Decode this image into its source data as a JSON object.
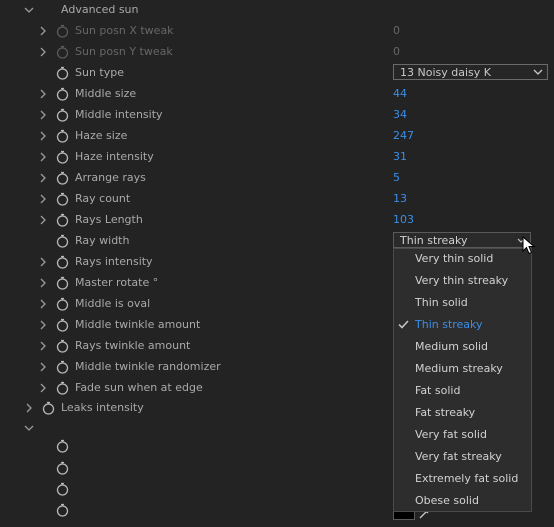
{
  "section": {
    "title": "Advanced sun"
  },
  "rows": [
    {
      "label": "Sun posn X tweak",
      "value": "0",
      "disabled": true
    },
    {
      "label": "Sun posn Y tweak",
      "value": "0",
      "disabled": true
    },
    {
      "label": "Sun type",
      "select": "13 Noisy daisy K"
    },
    {
      "label": "Middle size",
      "value": "44"
    },
    {
      "label": "Middle intensity",
      "value": "34"
    },
    {
      "label": "Haze size",
      "value": "247"
    },
    {
      "label": "Haze intensity",
      "value": "31"
    },
    {
      "label": "Arrange rays",
      "value": "5"
    },
    {
      "label": "Ray count",
      "value": "13"
    },
    {
      "label": "Rays Length",
      "value": "103"
    },
    {
      "label": "Ray width",
      "select": "Thin streaky"
    },
    {
      "label": "Rays intensity"
    },
    {
      "label": "Master rotate °"
    },
    {
      "label": "Middle is oval"
    },
    {
      "label": "Middle twinkle amount"
    },
    {
      "label": "Rays twinkle amount"
    },
    {
      "label": "Middle twinkle randomizer"
    },
    {
      "label": "Fade sun when at edge"
    }
  ],
  "leaks": {
    "label": "Leaks intensity"
  },
  "ray_width_options": [
    "Very thin solid",
    "Very thin streaky",
    "Thin solid",
    "Thin streaky",
    "Medium solid",
    "Medium streaky",
    "Fat solid",
    "Fat streaky",
    "Very fat solid",
    "Very fat streaky",
    "Extremely fat solid",
    "Obese solid"
  ],
  "ray_width_selected": "Thin streaky",
  "colors": {
    "background": "#232323",
    "accent": "#3a8ee6"
  },
  "icons": [
    "chevron-down-icon",
    "chevron-right-icon",
    "stopwatch-icon",
    "check-icon",
    "eyedropper-icon",
    "mouse-cursor-icon"
  ]
}
